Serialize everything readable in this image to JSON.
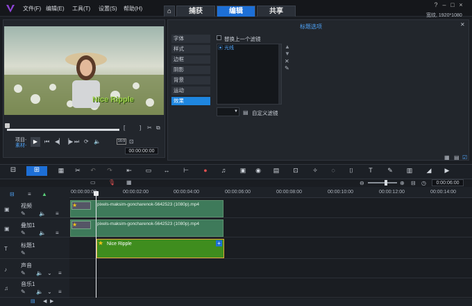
{
  "menu": {
    "file": "文件(F)",
    "edit": "编辑(E)",
    "tools": "工具(T)",
    "settings": "设置(S)",
    "help": "帮助(H)"
  },
  "tabs": {
    "home_icon": "home-icon",
    "capture": "捕获",
    "edit": "编辑",
    "share": "共享"
  },
  "resolution": "宽纹, 1920*1080",
  "preview": {
    "overlay_title": "Nice Ripple",
    "label_project": "项目-",
    "label_clip": "素材-",
    "timecode": "00:00:00:00",
    "zoom": "16:9"
  },
  "options": {
    "header": "标题选项",
    "items": [
      "字体",
      "样式",
      "边框",
      "阴影",
      "背景",
      "运动",
      "效果"
    ],
    "active": "效果",
    "replace_filter": "替换上一个滤镜",
    "filter_name": "光线",
    "custom_filter": "自定义滤镜"
  },
  "timeline": {
    "ruler": [
      "00:00:00:00",
      "00:00:02:00",
      "00:00:04:00",
      "00:00:06:00",
      "00:00:08:00",
      "00:00:10:00",
      "00:00:12:00",
      "00:00:14:00"
    ],
    "zoom_timecode": "0:00:06:00",
    "tracks": [
      {
        "name": "视频",
        "clip": "pixels-maksim-goncharenok-5642523 (1080p).mp4"
      },
      {
        "name": "叠加1",
        "clip": "pixels-maksim-goncharenok-5642523 (1080p).mp4"
      },
      {
        "name": "标题1",
        "clip": "Nice Ripple"
      },
      {
        "name": "声音",
        "clip": ""
      },
      {
        "name": "音乐1",
        "clip": ""
      }
    ]
  },
  "colors": {
    "accent": "#1d6fd6",
    "video_clip": "#3e7a5a",
    "title_clip": "#3f8d1e"
  }
}
